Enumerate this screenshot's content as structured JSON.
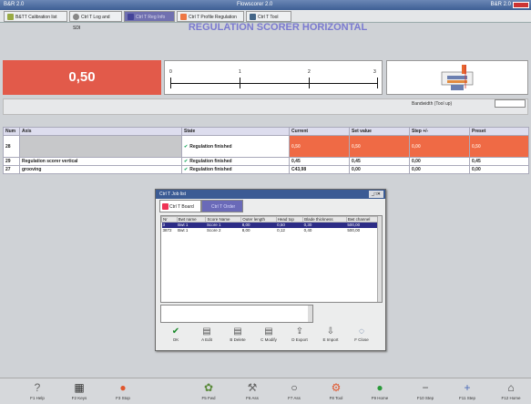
{
  "window": {
    "title_left": "B&R 2.0",
    "title_center": "Flowscorer 2.0",
    "title_right": "B&R 2.0"
  },
  "tabs": [
    {
      "label": "B&TT Calibration list",
      "icon": "pin-icon",
      "color": "#9a4",
      "active": false
    },
    {
      "label": "Ctrl T Log and SDI",
      "icon": "gear-icon",
      "color": "#888",
      "active": false
    },
    {
      "label": "Ctrl T Reg Info",
      "icon": "grid-icon",
      "color": "#449",
      "active": true
    },
    {
      "label": "Ctrl T Profile Regulation",
      "icon": "chart-icon",
      "color": "#e74",
      "active": false
    },
    {
      "label": "Ctrl T Tool",
      "icon": "tool-icon",
      "color": "#468",
      "active": false
    }
  ],
  "heading": "REGULATION SCORER HORIZONTAL",
  "current_value": "0,50",
  "scale": {
    "labels": [
      "0",
      "1",
      "2",
      "3"
    ]
  },
  "band": {
    "label": "Bandwidth (Tool up)",
    "value": ""
  },
  "table": {
    "headers": [
      "Num",
      "Axis",
      "State",
      "Current",
      "Set value",
      "Step +/-",
      "Preset"
    ],
    "rows": [
      {
        "num": "28",
        "axis": "",
        "state": "Regulation finished",
        "current": "0,50",
        "set": "0,50",
        "step": "0,00",
        "preset": "0,50"
      },
      {
        "num": "29",
        "axis": "Regulation scorer vertical",
        "state": "Regulation finished",
        "current": "0,45",
        "set": "0,45",
        "step": "0,00",
        "preset": "0,45"
      },
      {
        "num": "27",
        "axis": "grooving",
        "state": "Regulation finished",
        "current": "C43,98",
        "set": "0,00",
        "step": "0,00",
        "preset": "0,00"
      }
    ]
  },
  "dialog": {
    "title": "Ctrl T Job list",
    "tab1": "Ctrl T Board",
    "tab2": "Ctrl T Order",
    "headers": [
      "Nr",
      "Bwt name",
      "Score Name",
      "Outer length",
      "Head top",
      "Blade thickness",
      "Bwt channel"
    ],
    "rows": [
      {
        "c": [
          "3",
          "Bwt 1",
          "Score 1",
          "8,00",
          "0,50",
          "0,30",
          "500,00"
        ],
        "sel": true
      },
      {
        "c": [
          "3872",
          "Bwt 1",
          "Score 2",
          "8,00",
          "0,12",
          "0,40",
          "500,00"
        ],
        "sel": false
      }
    ],
    "buttons": [
      {
        "label": "OK",
        "icon": "check-icon"
      },
      {
        "label": "A Edit",
        "icon": "edit-icon"
      },
      {
        "label": "B Delete",
        "icon": "delete-icon"
      },
      {
        "label": "C Modify",
        "icon": "modify-icon"
      },
      {
        "label": "D Export",
        "icon": "export-icon"
      },
      {
        "label": "E Import",
        "icon": "import-icon"
      },
      {
        "label": "F Close",
        "icon": "close-icon"
      }
    ]
  },
  "taskbar": [
    {
      "label": "F1 Help",
      "icon": "help-icon"
    },
    {
      "label": "F2 Keys",
      "icon": "keyboard-icon"
    },
    {
      "label": "F3 Stop",
      "icon": "stop-icon"
    },
    {
      "label": "F5 Fwd",
      "icon": "fwd-icon"
    },
    {
      "label": "F6 Ass",
      "icon": "tool-icon"
    },
    {
      "label": "F7 Ass",
      "icon": "ring-icon"
    },
    {
      "label": "F8 Tool",
      "icon": "tool2-icon"
    },
    {
      "label": "F9 Home",
      "icon": "home-green-icon"
    },
    {
      "label": "F10 Step",
      "icon": "minus-icon"
    },
    {
      "label": "F11 Step",
      "icon": "plus-icon"
    },
    {
      "label": "F12 Home",
      "icon": "house-icon"
    }
  ]
}
